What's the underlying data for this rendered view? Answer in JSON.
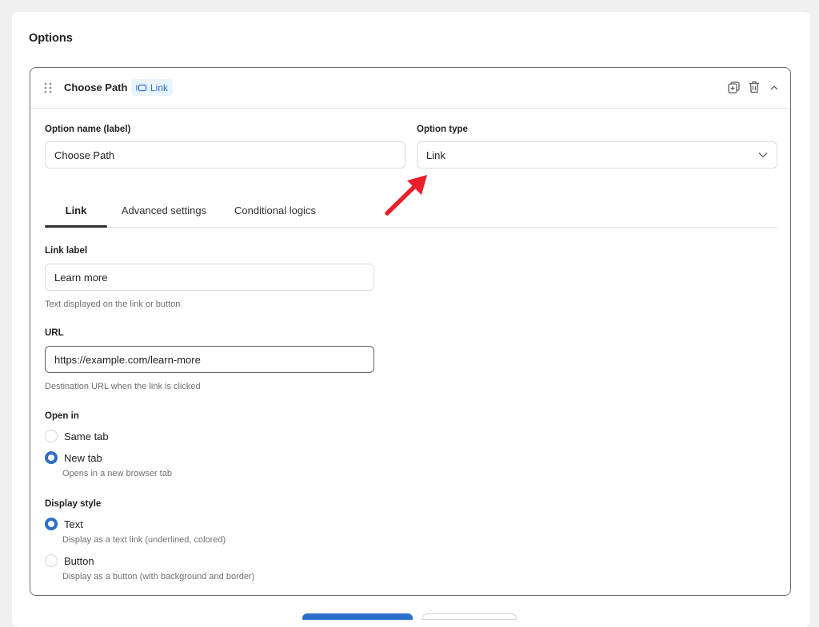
{
  "section": {
    "title": "Options"
  },
  "option": {
    "title": "Choose Path",
    "badge_label": "Link"
  },
  "fields": {
    "option_name_label": "Option name (label)",
    "option_name_value": "Choose Path",
    "option_type_label": "Option type",
    "option_type_value": "Link"
  },
  "tabs": [
    {
      "label": "Link",
      "active": true
    },
    {
      "label": "Advanced settings",
      "active": false
    },
    {
      "label": "Conditional logics",
      "active": false
    }
  ],
  "link_settings": {
    "link_label_label": "Link label",
    "link_label_value": "Learn more",
    "link_label_help": "Text displayed on the link or button",
    "url_label": "URL",
    "url_value": "https://example.com/learn-more",
    "url_help": "Destination URL when the link is clicked",
    "open_in_label": "Open in",
    "open_in_options": [
      {
        "label": "Same tab",
        "checked": false,
        "help": ""
      },
      {
        "label": "New tab",
        "checked": true,
        "help": "Opens in a new browser tab"
      }
    ],
    "display_style_label": "Display style",
    "display_style_options": [
      {
        "label": "Text",
        "checked": true,
        "help": "Display as a text link (underlined, colored)"
      },
      {
        "label": "Button",
        "checked": false,
        "help": "Display as a button (with background and border)"
      }
    ]
  },
  "colors": {
    "accent": "#2c6ecb",
    "annotation_arrow": "#e8202a"
  },
  "icons": {
    "drag": "drag-handle-icon",
    "badge": "link-icon",
    "duplicate": "duplicate-icon",
    "delete": "trash-icon",
    "collapse": "chevron-up-icon",
    "select": "chevron-down-icon"
  }
}
